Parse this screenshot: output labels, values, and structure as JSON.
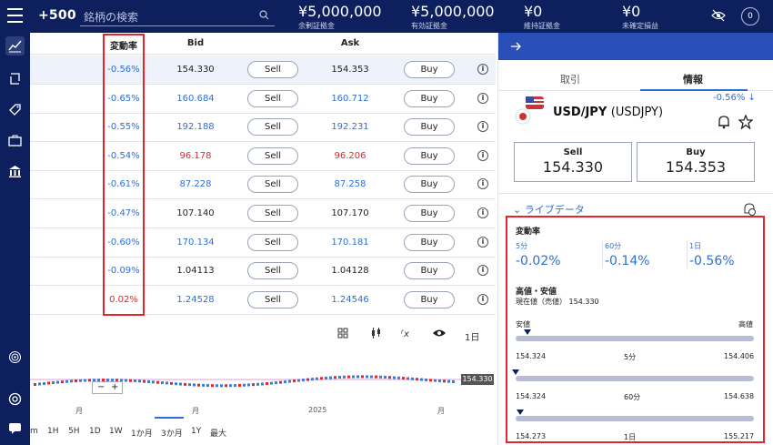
{
  "header": {
    "logo": "+500",
    "search_placeholder": "銘柄の検索",
    "stats": [
      {
        "value": "¥5,000,000",
        "label": "余剰証拠金"
      },
      {
        "value": "¥5,000,000",
        "label": "有効証拠金"
      },
      {
        "value": "¥0",
        "label": "維持証拠金"
      },
      {
        "value": "¥0",
        "label": "未確定損益"
      }
    ],
    "avatar": "0"
  },
  "sidenav": {
    "icons": [
      "chart-icon",
      "exchange-icon",
      "tag-icon",
      "briefcase-icon",
      "bank-icon",
      "fingerprint-icon",
      "target-icon",
      "chat-icon"
    ]
  },
  "table": {
    "headers": {
      "change": "変動率",
      "bid": "Bid",
      "ask": "Ask"
    },
    "sell_label": "Sell",
    "buy_label": "Buy",
    "info_glyph": "i",
    "rows": [
      {
        "change": "-0.56%",
        "bid": "154.330",
        "ask": "154.353",
        "change_color": "blue",
        "price_color": "black"
      },
      {
        "change": "-0.65%",
        "bid": "160.684",
        "ask": "160.712",
        "change_color": "blue",
        "price_color": "blue"
      },
      {
        "change": "-0.55%",
        "bid": "192.188",
        "ask": "192.231",
        "change_color": "blue",
        "price_color": "blue"
      },
      {
        "change": "-0.54%",
        "bid": "96.178",
        "ask": "96.206",
        "change_color": "blue",
        "price_color": "red"
      },
      {
        "change": "-0.61%",
        "bid": "87.228",
        "ask": "87.258",
        "change_color": "blue",
        "price_color": "blue"
      },
      {
        "change": "-0.47%",
        "bid": "107.140",
        "ask": "107.170",
        "change_color": "blue",
        "price_color": "black"
      },
      {
        "change": "-0.60%",
        "bid": "170.134",
        "ask": "170.181",
        "change_color": "blue",
        "price_color": "blue"
      },
      {
        "change": "-0.09%",
        "bid": "1.04113",
        "ask": "1.04128",
        "change_color": "blue",
        "price_color": "black"
      },
      {
        "change": "0.02%",
        "bid": "1.24528",
        "ask": "1.24546",
        "change_color": "red",
        "price_color": "blue"
      }
    ]
  },
  "chart": {
    "interval": "1日",
    "price_tag": "154.330",
    "zoom_out": "−",
    "zoom_in": "+",
    "x_labels": [
      "月",
      "月",
      "2025",
      "月"
    ],
    "timeframes": [
      "m",
      "1H",
      "5H",
      "1D",
      "1W",
      "1か月",
      "3か月",
      "1Y",
      "最大"
    ],
    "active_timeframe": "3か月"
  },
  "panel": {
    "tabs": [
      "取引",
      "情報"
    ],
    "active_tab": "情報",
    "symbol": "USD/JPY",
    "symbol_code": "(USDJPY)",
    "change": "-0.56% ↓",
    "sell": {
      "label": "Sell",
      "price": "154.330"
    },
    "buy": {
      "label": "Buy",
      "price": "154.353"
    },
    "live_data_label": "ライブデータ",
    "volatility_title": "変動率",
    "periods": [
      {
        "label": "5分",
        "value": "-0.02%"
      },
      {
        "label": "60分",
        "value": "-0.14%"
      },
      {
        "label": "1日",
        "value": "-0.56%"
      }
    ],
    "high_low_title": "高値・安値",
    "current_value": "現在値（売値） 154.330",
    "low_label": "安値",
    "high_label": "高値",
    "ranges": [
      {
        "low": "154.324",
        "period": "5分",
        "high": "154.406",
        "position": 0.05
      },
      {
        "low": "154.324",
        "period": "60分",
        "high": "154.638",
        "position": 0.0
      },
      {
        "low": "154.273",
        "period": "1日",
        "high": "155.217",
        "position": 0.02
      }
    ]
  }
}
